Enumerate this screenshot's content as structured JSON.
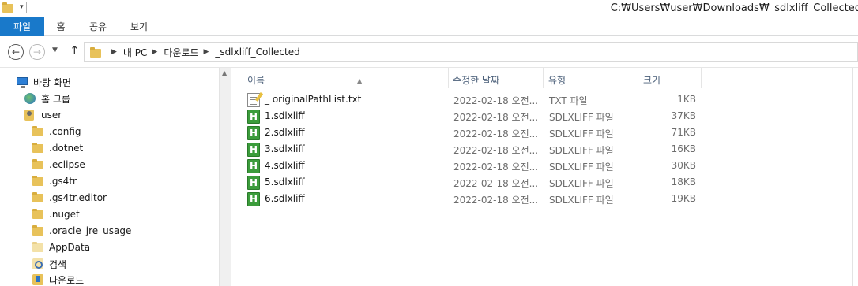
{
  "window": {
    "title": "C:₩Users₩user₩Downloads₩_sdlxliff_Collected"
  },
  "ribbon": {
    "tabs": [
      {
        "label": "파일"
      },
      {
        "label": "홈"
      },
      {
        "label": "공유"
      },
      {
        "label": "보기"
      }
    ]
  },
  "address": {
    "crumbs": [
      "내 PC",
      "다운로드",
      "_sdlxliff_Collected"
    ]
  },
  "nav_pane": {
    "items": [
      {
        "label": "바탕 화면",
        "icon": "desktop-icon"
      },
      {
        "label": "홈 그룹",
        "icon": "homegroup-icon"
      },
      {
        "label": "user",
        "icon": "user-folder-icon"
      },
      {
        "label": ".config",
        "icon": "folder-icon"
      },
      {
        "label": ".dotnet",
        "icon": "folder-icon"
      },
      {
        "label": ".eclipse",
        "icon": "folder-icon"
      },
      {
        "label": ".gs4tr",
        "icon": "folder-icon"
      },
      {
        "label": ".gs4tr.editor",
        "icon": "folder-icon"
      },
      {
        "label": ".nuget",
        "icon": "folder-icon"
      },
      {
        "label": ".oracle_jre_usage",
        "icon": "folder-icon"
      },
      {
        "label": "AppData",
        "icon": "folder-icon"
      },
      {
        "label": "검색",
        "icon": "search-folder-icon"
      },
      {
        "label": "다운로드",
        "icon": "downloads-folder-icon"
      }
    ]
  },
  "file_list": {
    "columns": {
      "name": "이름",
      "modified": "수정한 날짜",
      "type": "유형",
      "size": "크기"
    },
    "rows": [
      {
        "name": "_ originalPathList.txt",
        "modified": "2022-02-18 오전...",
        "type": "TXT 파일",
        "size": "1KB",
        "icon": "text-file-icon"
      },
      {
        "name": "1.sdlxliff",
        "modified": "2022-02-18 오전...",
        "type": "SDLXLIFF 파일",
        "size": "37KB",
        "icon": "sdlxliff-file-icon"
      },
      {
        "name": "2.sdlxliff",
        "modified": "2022-02-18 오전...",
        "type": "SDLXLIFF 파일",
        "size": "71KB",
        "icon": "sdlxliff-file-icon"
      },
      {
        "name": "3.sdlxliff",
        "modified": "2022-02-18 오전...",
        "type": "SDLXLIFF 파일",
        "size": "16KB",
        "icon": "sdlxliff-file-icon"
      },
      {
        "name": "4.sdlxliff",
        "modified": "2022-02-18 오전...",
        "type": "SDLXLIFF 파일",
        "size": "30KB",
        "icon": "sdlxliff-file-icon"
      },
      {
        "name": "5.sdlxliff",
        "modified": "2022-02-18 오전...",
        "type": "SDLXLIFF 파일",
        "size": "18KB",
        "icon": "sdlxliff-file-icon"
      },
      {
        "name": "6.sdlxliff",
        "modified": "2022-02-18 오전...",
        "type": "SDLXLIFF 파일",
        "size": "19KB",
        "icon": "sdlxliff-file-icon"
      }
    ]
  },
  "colors": {
    "file_tab": "#1979ca",
    "header_text": "#4c607a",
    "sdlxliff_icon": "#3b9c3b"
  }
}
